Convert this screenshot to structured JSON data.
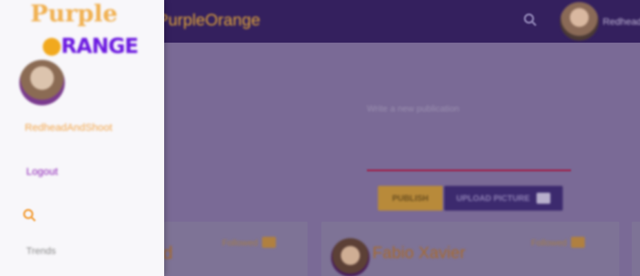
{
  "header": {
    "title": "PurpleOrange",
    "search_icon": "search-icon",
    "username": "Redhead"
  },
  "logo": {
    "line1": "Purple",
    "line2": "RANGE"
  },
  "drawer": {
    "username": "RedheadAndShoot",
    "logout_label": "Logout",
    "search_icon": "search-icon",
    "trends_label": "Trends"
  },
  "composer": {
    "placeholder": "Write a new publication",
    "publish_label": "PUBLISH",
    "upload_label": "UPLOAD PICTURE"
  },
  "cards": [
    {
      "name_partial": "d",
      "follow_label": "Followed"
    },
    {
      "name": "Fabio Xavier",
      "follow_label": "Followed"
    }
  ],
  "colors": {
    "header_bg": "#34205e",
    "accent_orange": "#f3a64a",
    "accent_purple": "#8b1fb5"
  }
}
